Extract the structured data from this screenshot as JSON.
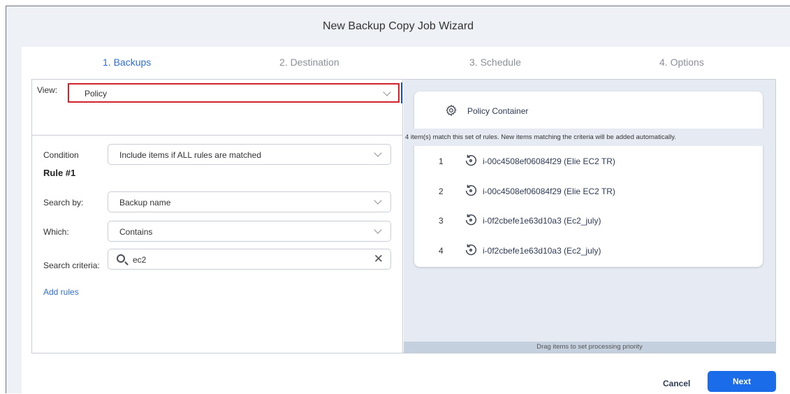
{
  "window": {
    "title": "New Backup Copy Job Wizard"
  },
  "steps": [
    {
      "label": "1. Backups",
      "active": true
    },
    {
      "label": "2. Destination",
      "active": false
    },
    {
      "label": "3. Schedule",
      "active": false
    },
    {
      "label": "4. Options",
      "active": false
    }
  ],
  "left": {
    "view_label": "View:",
    "view_value": "Policy",
    "condition_label": "Condition",
    "condition_value": "Include items if ALL rules are matched",
    "rule_title": "Rule #1",
    "search_by_label": "Search by:",
    "search_by_value": "Backup name",
    "which_label": "Which:",
    "which_value": "Contains",
    "criteria_label": "Search criteria:",
    "criteria_value": "ec2",
    "add_rules": "Add rules"
  },
  "right": {
    "container_title": "Policy Container",
    "match_text": "4 item(s) match this set of rules. New items matching the criteria will be added automatically.",
    "items": [
      {
        "num": "1",
        "name": "i-00c4508ef06084f29 (Elie EC2 TR)"
      },
      {
        "num": "2",
        "name": "i-00c4508ef06084f29 (Elie EC2 TR)"
      },
      {
        "num": "3",
        "name": "i-0f2cbefe1e63d10a3 (Ec2_july)"
      },
      {
        "num": "4",
        "name": "i-0f2cbefe1e63d10a3 (Ec2_july)"
      }
    ],
    "drag_hint": "Drag items to set processing priority"
  },
  "footer": {
    "cancel": "Cancel",
    "next": "Next"
  },
  "colors": {
    "accent": "#1a6ce8",
    "highlight_border": "#d0232b",
    "active_step": "#2e6ed6"
  }
}
